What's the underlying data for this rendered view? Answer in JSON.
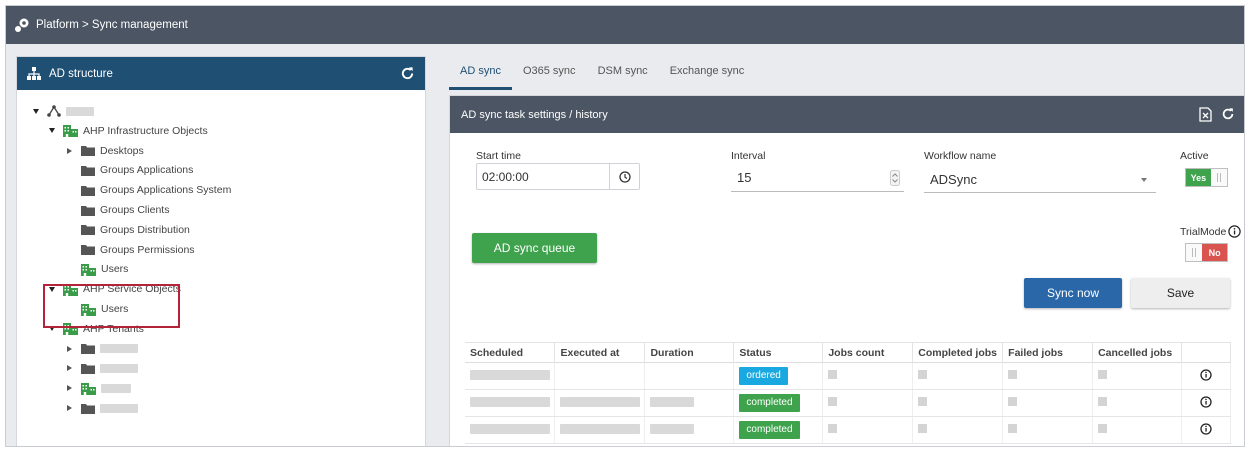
{
  "header": {
    "breadcrumb": "Platform > Sync management"
  },
  "left_panel": {
    "title": "AD structure",
    "tree": [
      {
        "label": "",
        "blurred": true,
        "level": 0,
        "state": "expanded",
        "icon": "root-icon"
      },
      {
        "label": "AHP Infrastructure Objects",
        "level": 1,
        "state": "expanded",
        "icon": "building-icon"
      },
      {
        "label": "Desktops",
        "level": 2,
        "state": "collapsed",
        "icon": "folder-icon"
      },
      {
        "label": "Groups Applications",
        "level": 2,
        "state": "leaf",
        "icon": "folder-icon"
      },
      {
        "label": "Groups Applications System",
        "level": 2,
        "state": "leaf",
        "icon": "folder-icon"
      },
      {
        "label": "Groups Clients",
        "level": 2,
        "state": "leaf",
        "icon": "folder-icon"
      },
      {
        "label": "Groups Distribution",
        "level": 2,
        "state": "leaf",
        "icon": "folder-icon"
      },
      {
        "label": "Groups Permissions",
        "level": 2,
        "state": "leaf",
        "icon": "folder-icon"
      },
      {
        "label": "Users",
        "level": 2,
        "state": "leaf",
        "icon": "building-icon"
      },
      {
        "label": "AHP Service Objects",
        "level": 1,
        "state": "expanded",
        "icon": "building-icon"
      },
      {
        "label": "Users",
        "level": 2,
        "state": "leaf",
        "icon": "building-icon"
      },
      {
        "label": "AHP Tenants",
        "level": 1,
        "state": "expanded",
        "icon": "building-icon"
      },
      {
        "label": "",
        "blurred": true,
        "level": 2,
        "state": "collapsed",
        "icon": "folder-icon"
      },
      {
        "label": "",
        "blurred": true,
        "level": 2,
        "state": "collapsed",
        "icon": "folder-icon"
      },
      {
        "label": "",
        "blurred": true,
        "level": 2,
        "state": "collapsed",
        "icon": "building-icon"
      },
      {
        "label": "",
        "blurred": true,
        "level": 2,
        "state": "collapsed",
        "icon": "folder-icon"
      }
    ]
  },
  "tabs": [
    "AD sync",
    "O365 sync",
    "DSM sync",
    "Exchange sync"
  ],
  "panel": {
    "title": "AD sync task settings / history",
    "start_time_label": "Start time",
    "start_time_value": "02:00:00",
    "interval_label": "Interval",
    "interval_value": "15",
    "workflow_label": "Workflow name",
    "workflow_value": "ADSync",
    "active_label": "Active",
    "active_toggle": "Yes",
    "trial_label": "TrialMode",
    "trial_toggle": "No",
    "queue_button": "AD sync queue",
    "sync_now_button": "Sync now",
    "save_button": "Save"
  },
  "history": {
    "columns": [
      "Scheduled",
      "Executed at",
      "Duration",
      "Status",
      "Jobs count",
      "Completed jobs",
      "Failed jobs",
      "Cancelled jobs"
    ],
    "rows": [
      {
        "status": "ordered"
      },
      {
        "status": "completed"
      },
      {
        "status": "completed"
      }
    ]
  },
  "colors": {
    "primary_dark": "#1f4f73",
    "header_grey": "#4b5563",
    "green": "#3fa34d",
    "blue": "#2a67a8",
    "ordered": "#19a9e0",
    "red": "#d9534f"
  }
}
